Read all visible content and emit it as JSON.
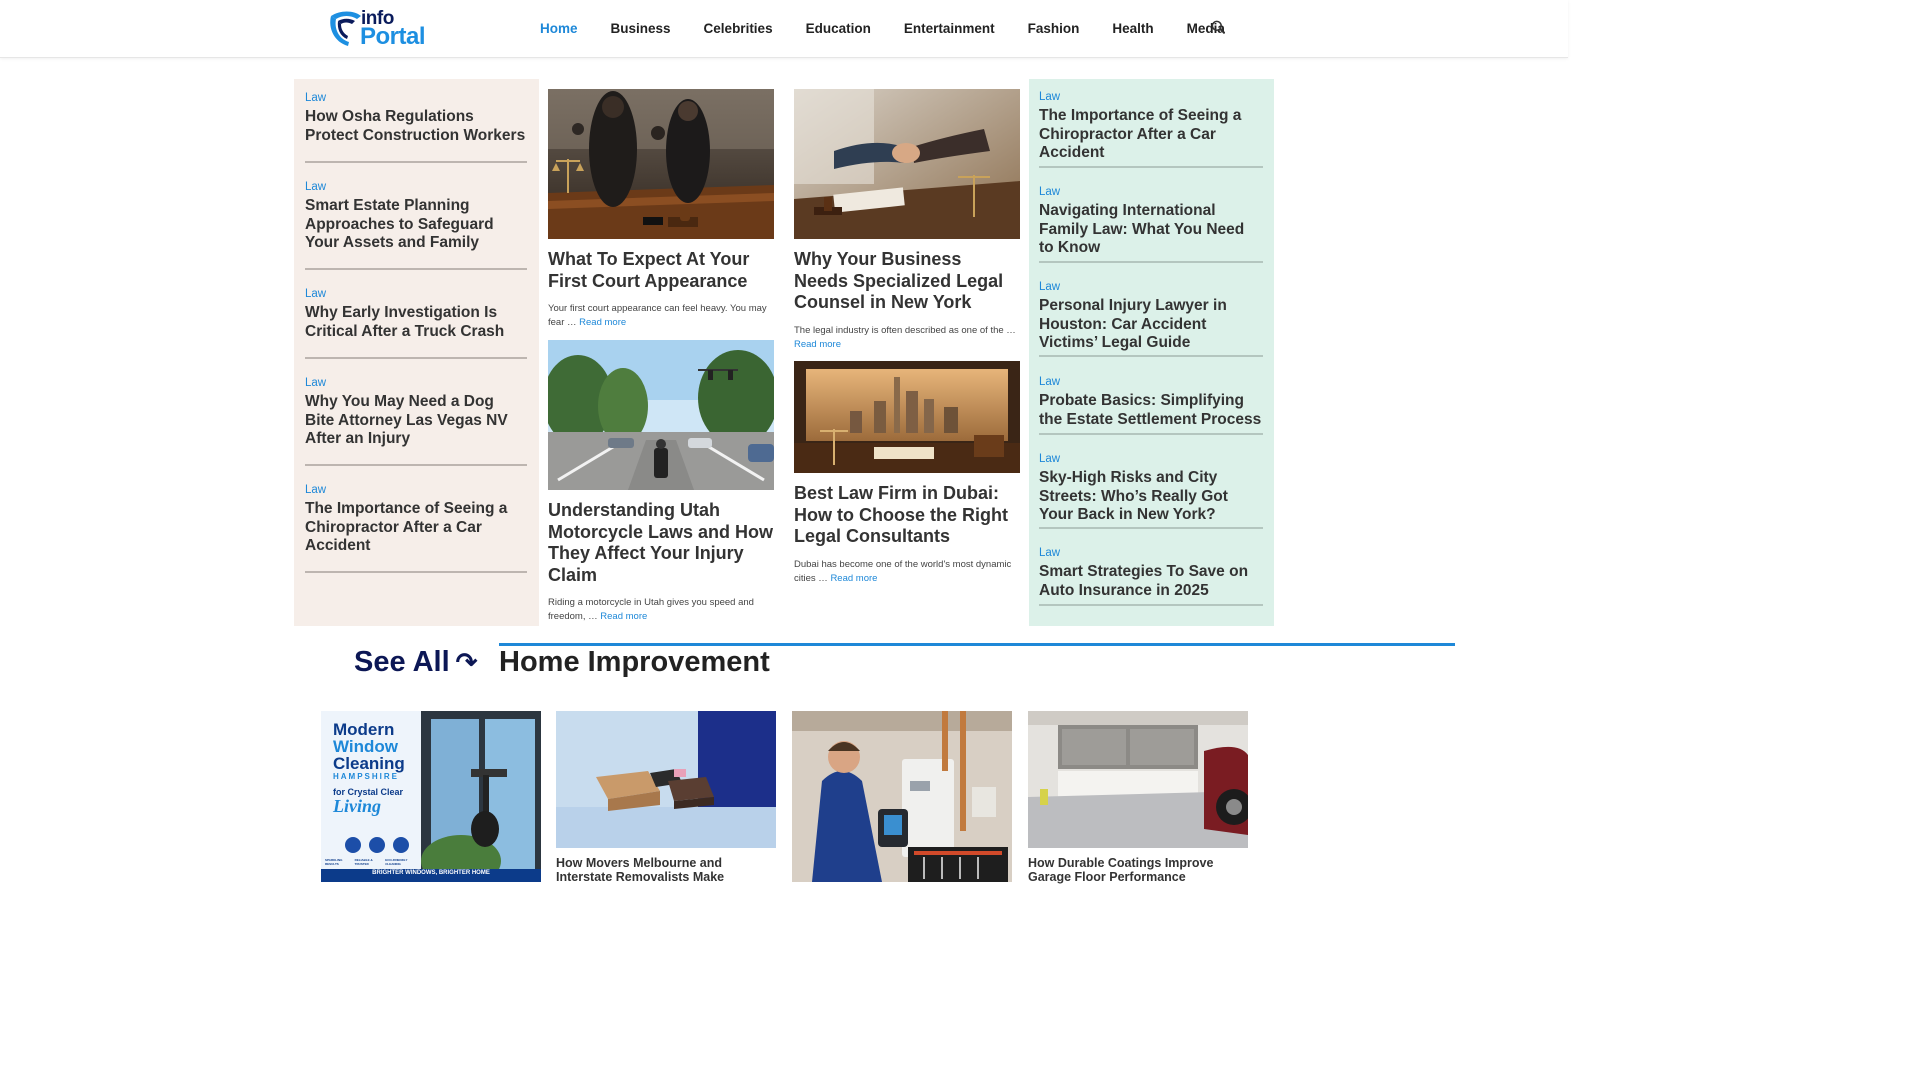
{
  "header": {
    "logo": {
      "line1": "info",
      "line2": "Portal"
    },
    "nav": [
      "Home",
      "Business",
      "Celebrities",
      "Education",
      "Entertainment",
      "Fashion",
      "Health",
      "Media"
    ],
    "active": "Home"
  },
  "left_list": [
    {
      "category": "Law",
      "title": "How Osha Regulations Protect Construction Workers"
    },
    {
      "category": "Law",
      "title": "Smart Estate Planning Approaches to Safeguard Your Assets and Family"
    },
    {
      "category": "Law",
      "title": "Why Early Investigation Is Critical After a Truck Crash"
    },
    {
      "category": "Law",
      "title": "Why You May Need a Dog Bite Attorney Las Vegas NV After an Injury"
    },
    {
      "category": "Law",
      "title": "The Importance of Seeing a Chiropractor After a Car Accident"
    }
  ],
  "center_cards": [
    {
      "title": "What To Expect At Your First Court Appearance",
      "excerpt": "Your first court appearance can feel heavy. You may fear …",
      "more": "Read more"
    },
    {
      "title": "Why Your Business Needs Specialized Legal Counsel in New York",
      "excerpt": "The legal industry is often described as one of the …",
      "more": "Read more"
    },
    {
      "title": "Understanding Utah Motorcycle Laws and How They Affect Your Injury Claim",
      "excerpt": "Riding a motorcycle in Utah gives you speed and freedom, …",
      "more": "Read more"
    },
    {
      "title": "Best Law Firm in Dubai: How to Choose the Right Legal Consultants",
      "excerpt": "Dubai has become one of the world's most dynamic cities …",
      "more": "Read more"
    }
  ],
  "right_list": [
    {
      "category": "Law",
      "title": "The Importance of Seeing a Chiropractor After a Car Accident"
    },
    {
      "category": "Law",
      "title": "Navigating International Family Law: What You Need to Know"
    },
    {
      "category": "Law",
      "title": "Personal Injury Lawyer in Houston: Car Accident Victims’ Legal Guide"
    },
    {
      "category": "Law",
      "title": "Probate Basics: Simplifying the Estate Settlement Process"
    },
    {
      "category": "Law",
      "title": "Sky-High Risks and City Streets: Who’s Really Got Your Back in New York?"
    },
    {
      "category": "Law",
      "title": "Smart Strategies To Save on Auto Insurance in 2025"
    }
  ],
  "see_all": {
    "label": "See All",
    "arrow": "↷"
  },
  "home_improvement": {
    "heading": "Home Improvement",
    "poster": {
      "line1": "Modern",
      "line2": "Window",
      "line3": "Cleaning",
      "line4": "HAMPSHIRE",
      "line5": "for Crystal Clear",
      "line6": "Living",
      "features": [
        "SPARKLING RESULTS",
        "RELIABLE & TRUSTED",
        "ECO-FRIENDLY CLEANING"
      ],
      "banner": "BRIGHTER WINDOWS, BRIGHTER HOME"
    },
    "cards": [
      {
        "caption": "How Movers Melbourne and Interstate Removalists Make"
      },
      {
        "caption": "How Durable Coatings Improve Garage Floor Performance"
      }
    ]
  },
  "colors": {
    "accent": "#1e88d8",
    "navy": "#0c1755",
    "left_bg": "#f6eee9",
    "right_bg": "#dcf1e9"
  }
}
